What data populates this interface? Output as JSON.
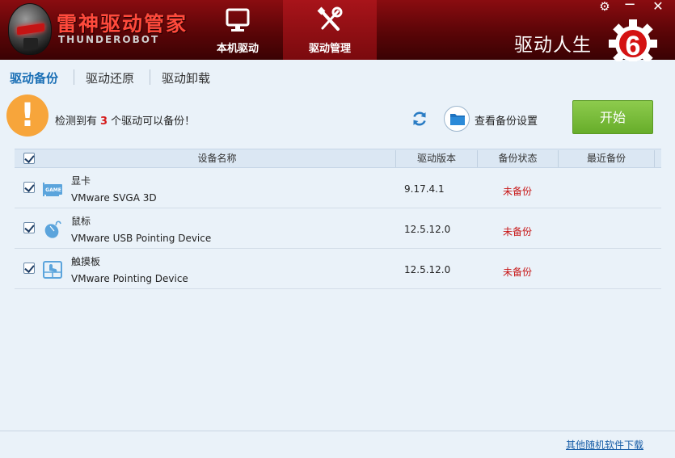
{
  "app": {
    "title_cn": "雷神驱动管家",
    "title_en": "THUNDEROBOT",
    "brand": "驱动人生",
    "brand_badge": "6"
  },
  "nav": {
    "tabs": [
      {
        "label": "本机驱动",
        "icon": "monitor-icon",
        "active": false
      },
      {
        "label": "驱动管理",
        "icon": "tools-icon",
        "active": true
      }
    ]
  },
  "window_controls": {
    "settings": "⚙",
    "minimize": "−",
    "close": "✕"
  },
  "subtabs": [
    {
      "label": "驱动备份",
      "active": true
    },
    {
      "label": "驱动还原",
      "active": false
    },
    {
      "label": "驱动卸载",
      "active": false
    }
  ],
  "notice": {
    "icon": "!",
    "prefix": "检测到有",
    "count": "3",
    "suffix": "个驱动可以备份！"
  },
  "toolbar": {
    "settings_label": "查看备份设置",
    "start_label": "开始"
  },
  "table": {
    "headers": [
      "设备名称",
      "驱动版本",
      "备份状态",
      "最近备份"
    ],
    "rows": [
      {
        "category": "显卡",
        "icon": "graphics-card-icon",
        "name": "VMware SVGA 3D",
        "version": "9.17.4.1",
        "status": "未备份",
        "last_backup": "",
        "checked": true
      },
      {
        "category": "鼠标",
        "icon": "mouse-icon",
        "name": "VMware USB Pointing Device",
        "version": "12.5.12.0",
        "status": "未备份",
        "last_backup": "",
        "checked": true
      },
      {
        "category": "触摸板",
        "icon": "touchpad-icon",
        "name": "VMware Pointing Device",
        "version": "12.5.12.0",
        "status": "未备份",
        "last_backup": "",
        "checked": true
      }
    ]
  },
  "footer": {
    "link": "其他随机软件下载"
  },
  "colors": {
    "header_red": "#7a0a0e",
    "accent_blue": "#1a6fb5",
    "start_green": "#76bb35",
    "warn_orange": "#f7a53b",
    "status_red": "#c81818"
  }
}
